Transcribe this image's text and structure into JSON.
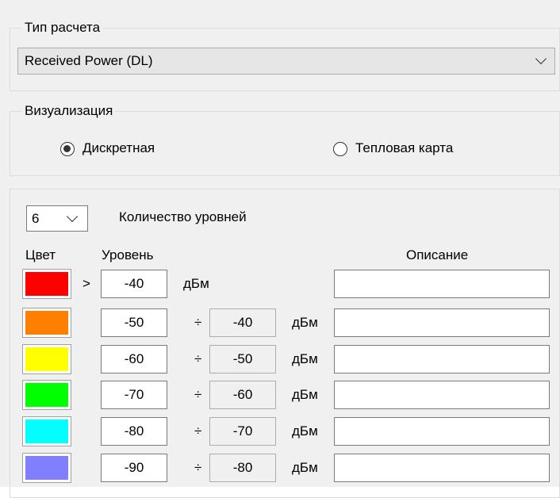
{
  "calc_type": {
    "legend": "Тип расчета",
    "selected": "Received Power (DL)"
  },
  "visualization": {
    "legend": "Визуализация",
    "options": [
      {
        "label": "Дискретная",
        "checked": true
      },
      {
        "label": "Тепловая карта",
        "checked": false
      }
    ]
  },
  "levels": {
    "count": "6",
    "count_label": "Количество уровней",
    "headers": {
      "color": "Цвет",
      "level": "Уровень",
      "description": "Описание"
    },
    "gt_symbol": ">",
    "range_symbol": "÷",
    "unit": "дБм",
    "rows": [
      {
        "color": "#ff0000",
        "from": "-40",
        "to": "",
        "description": ""
      },
      {
        "color": "#ff8000",
        "from": "-50",
        "to": "-40",
        "description": ""
      },
      {
        "color": "#ffff00",
        "from": "-60",
        "to": "-50",
        "description": ""
      },
      {
        "color": "#00ff00",
        "from": "-70",
        "to": "-60",
        "description": ""
      },
      {
        "color": "#00ffff",
        "from": "-80",
        "to": "-70",
        "description": ""
      },
      {
        "color": "#8080ff",
        "from": "-90",
        "to": "-80",
        "description": ""
      }
    ]
  }
}
